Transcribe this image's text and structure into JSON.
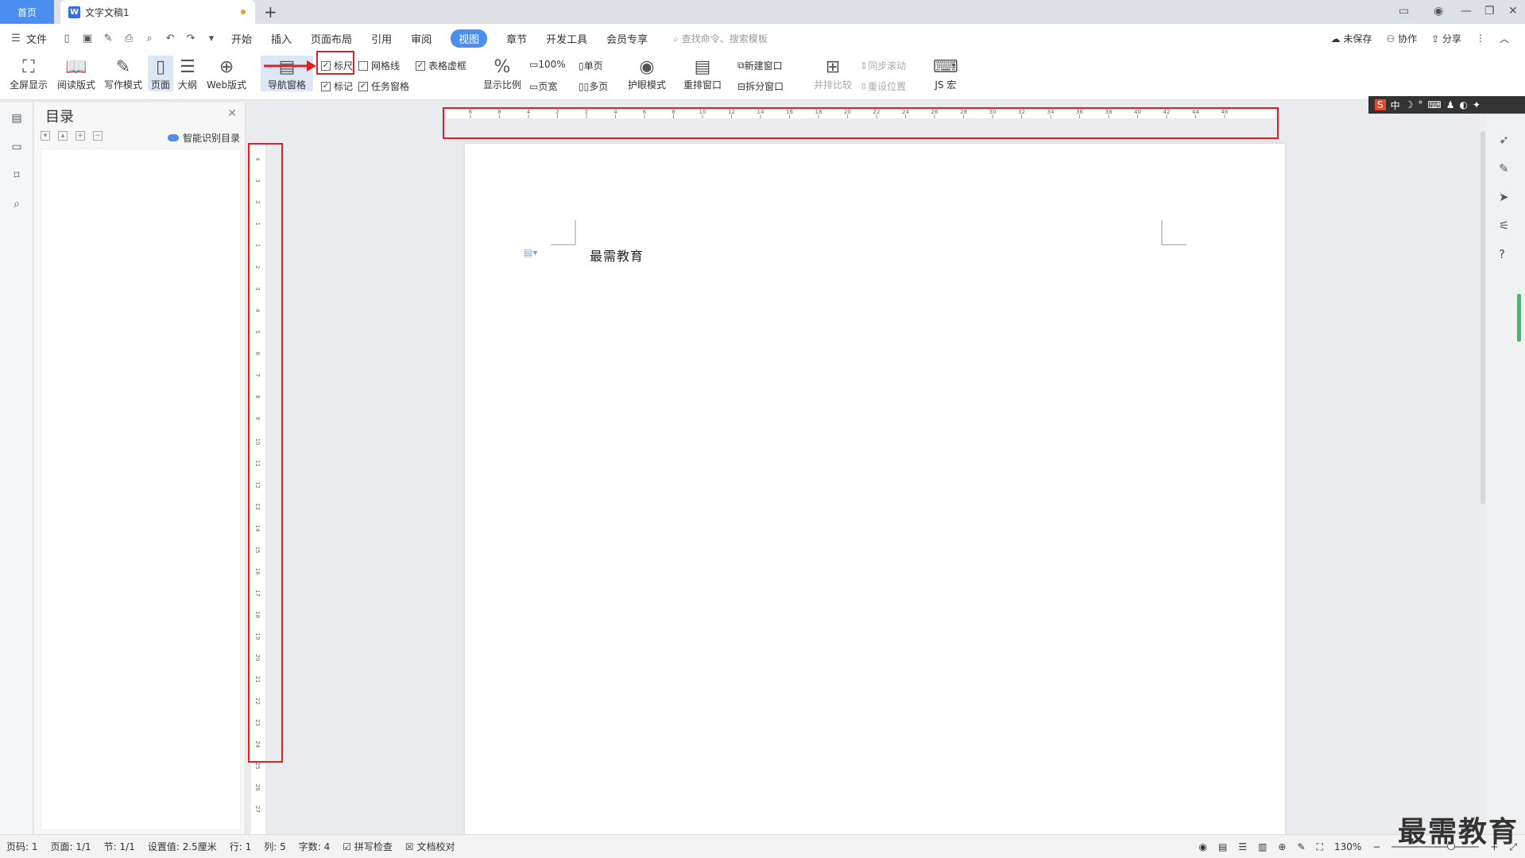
{
  "tabs": {
    "home": "首页",
    "doc": "文字文稿1"
  },
  "menu": {
    "file": "文件",
    "items": [
      "开始",
      "插入",
      "页面布局",
      "引用",
      "审阅",
      "视图",
      "章节",
      "开发工具",
      "会员专享"
    ],
    "search": "查找命令、搜索模板",
    "unsaved": "未保存",
    "collab": "协作",
    "share": "分享"
  },
  "ribbon": {
    "fullscreen": "全屏显示",
    "reading": "阅读版式",
    "writing": "写作模式",
    "page": "页面",
    "outline": "大纲",
    "web": "Web版式",
    "navpane": "导航窗格",
    "ruler": "标尺",
    "gridlines": "网格线",
    "tablebox": "表格虚框",
    "mark": "标记",
    "taskpane": "任务窗格",
    "zoom": "显示比例",
    "hundred": "100%",
    "pagewidth": "页宽",
    "single": "单页",
    "multi": "多页",
    "eyecare": "护眼模式",
    "rearrange": "重排窗口",
    "newwin": "新建窗口",
    "split": "拆分窗口",
    "sidebyside": "并排比较",
    "syncscroll": "同步滚动",
    "resetpos": "重设位置",
    "macro": "JS 宏"
  },
  "nav": {
    "title": "目录",
    "smart": "智能识别目录"
  },
  "doc": {
    "text": "最需教育"
  },
  "ime": {
    "lang": "中"
  },
  "status": {
    "pageno": "页码: 1",
    "pages": "页面: 1/1",
    "section": "节: 1/1",
    "setting": "设置值: 2.5厘米",
    "row": "行: 1",
    "col": "列: 5",
    "words": "字数: 4",
    "spell": "拼写检查",
    "proof": "文档校对",
    "zoom": "130%"
  },
  "watermark": "最需教育",
  "hruler_ticks": [
    "6",
    "8",
    "4",
    "2",
    "2",
    "4",
    "6",
    "8",
    "10",
    "12",
    "14",
    "16",
    "18",
    "20",
    "22",
    "24",
    "26",
    "28",
    "30",
    "32",
    "34",
    "36",
    "38",
    "40",
    "42",
    "44",
    "46"
  ],
  "vruler_ticks": [
    "4",
    "3",
    "2",
    "1",
    "1",
    "2",
    "3",
    "4",
    "5",
    "6",
    "7",
    "8",
    "9",
    "10",
    "11",
    "12",
    "13",
    "14",
    "15",
    "16",
    "17",
    "18",
    "19",
    "20",
    "21",
    "22",
    "23",
    "24",
    "25",
    "26",
    "27"
  ]
}
